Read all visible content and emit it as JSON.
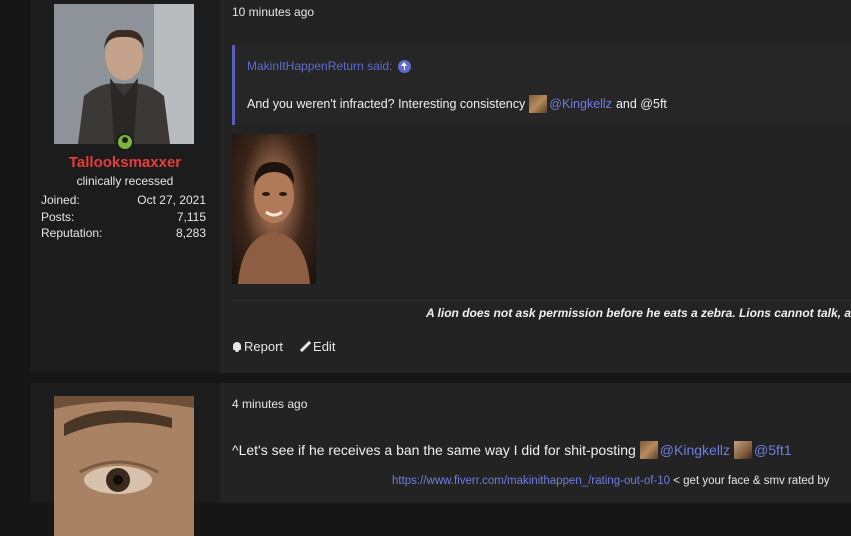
{
  "posts": [
    {
      "username": "Tallooksmaxxer",
      "user_title": "clinically recessed",
      "stats": [
        {
          "label": "Joined:",
          "value": "Oct 27, 2021"
        },
        {
          "label": "Posts:",
          "value": "7,115"
        },
        {
          "label": "Reputation:",
          "value": "8,283"
        }
      ],
      "time": "10 minutes ago",
      "quote": {
        "author_said": "MakinItHappenReturn said:",
        "text_before": "And you weren't infracted? Interesting consistency",
        "mention1": "@Kingkellz",
        "text_mid": "and @5ft"
      },
      "signature": "A lion does not ask permission before he eats a zebra. Lions cannot talk, a",
      "actions": {
        "report": "Report",
        "edit": "Edit"
      }
    },
    {
      "time": "4 minutes ago",
      "reply_text": "^Let's see if he receives a ban the same way I did for shit-posting",
      "mention1": "@Kingkellz",
      "mention2": "@5ft1",
      "link_url": "https://www.fiverr.com/makinithappen_/rating-out-of-10",
      "link_suffix": "< get your face & smv rated by"
    }
  ],
  "colors": {
    "background": "#161616",
    "post_bg": "#232323",
    "username": "#e83c3c",
    "link": "#6f7fe0",
    "online": "#7ab43a"
  }
}
